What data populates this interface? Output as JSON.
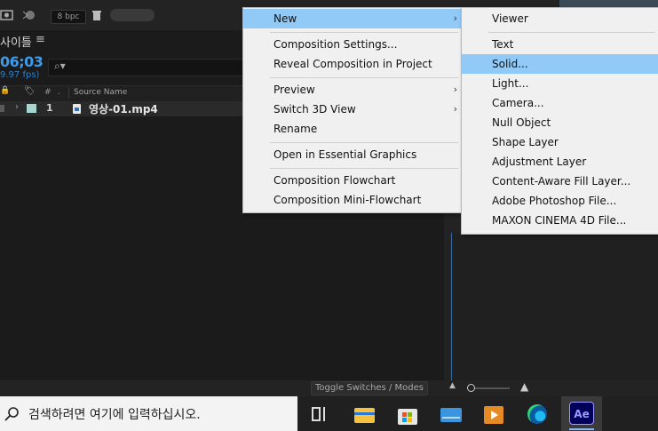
{
  "toolbar": {
    "bpc_label": "8 bpc"
  },
  "timeline": {
    "tab_title": "사이틀",
    "tab_menu_icon": "≡",
    "timecode": "06;03",
    "fps": "9.97 fps)",
    "search_icon": "⌕▾",
    "columns": {
      "lock": "🔒",
      "tag": "🏷",
      "num": "#",
      "dot": ".",
      "source_name": "Source Name"
    },
    "layers": [
      {
        "number": "1",
        "name": "영상-01.mp4",
        "label_color": "#a6d6d0"
      }
    ]
  },
  "status_bar": {
    "toggle_label": "Toggle Switches / Modes"
  },
  "context_menu": {
    "items": [
      {
        "label": "New",
        "has_submenu": true,
        "highlighted": true
      },
      {
        "label": "Composition Settings...",
        "has_submenu": false
      },
      {
        "label": "Reveal Composition in Project",
        "has_submenu": false
      },
      {
        "label": "Preview",
        "has_submenu": true
      },
      {
        "label": "Switch 3D View",
        "has_submenu": true
      },
      {
        "label": "Rename",
        "has_submenu": false
      },
      {
        "label": "Open in Essential Graphics",
        "has_submenu": false
      },
      {
        "label": "Composition Flowchart",
        "has_submenu": false
      },
      {
        "label": "Composition Mini-Flowchart",
        "has_submenu": false
      }
    ]
  },
  "submenu": {
    "items": [
      {
        "label": "Viewer"
      },
      {
        "label": "Text"
      },
      {
        "label": "Solid...",
        "highlighted": true
      },
      {
        "label": "Light..."
      },
      {
        "label": "Camera..."
      },
      {
        "label": "Null Object"
      },
      {
        "label": "Shape Layer"
      },
      {
        "label": "Adjustment Layer"
      },
      {
        "label": "Content-Aware Fill Layer..."
      },
      {
        "label": "Adobe Photoshop File..."
      },
      {
        "label": "MAXON CINEMA 4D File..."
      }
    ]
  },
  "taskbar": {
    "search_placeholder": "검색하려면 여기에 입력하십시오.",
    "apps": [
      "task-view",
      "file-explorer",
      "microsoft-store",
      "mail",
      "media-player",
      "edge",
      "after-effects"
    ],
    "after_effects_label": "Ae"
  },
  "colors": {
    "highlight": "#91c9f7",
    "timecode": "#3d9bea",
    "ae_bg": "#00005b",
    "ae_text": "#9a9aff"
  }
}
